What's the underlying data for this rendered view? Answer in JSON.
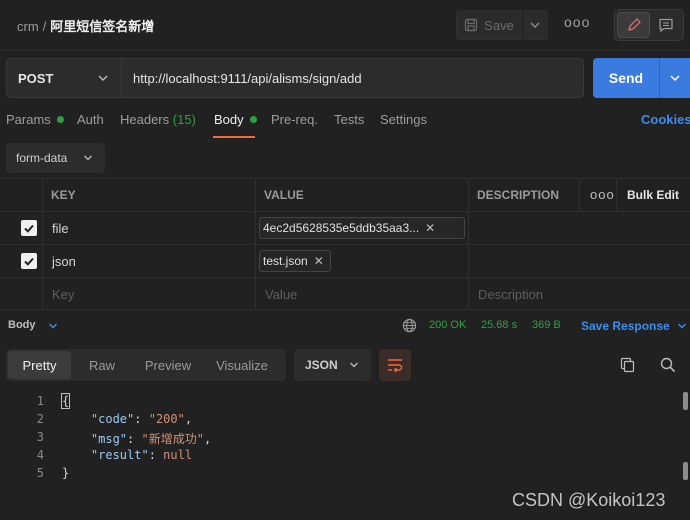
{
  "breadcrumb": {
    "workspace": "crm",
    "separator": "/",
    "request_name": "阿里短信签名新增"
  },
  "toolbar": {
    "save_label": "Save",
    "more": "ooo"
  },
  "request": {
    "method": "POST",
    "url": "http://localhost:9111/api/alisms/sign/add",
    "send_label": "Send"
  },
  "tabs": {
    "params": "Params",
    "auth": "Auth",
    "headers": "Headers",
    "headers_count": "(15)",
    "body": "Body",
    "prereq": "Pre-req.",
    "tests": "Tests",
    "settings": "Settings",
    "cookies": "Cookies"
  },
  "body_mode": "form-data",
  "table": {
    "headers": {
      "key": "KEY",
      "value": "VALUE",
      "description": "DESCRIPTION",
      "more": "ooo",
      "bulk_edit": "Bulk Edit"
    },
    "rows": [
      {
        "key": "file",
        "value": "4ec2d5628535e5ddb35aa3...",
        "checked": true
      },
      {
        "key": "json",
        "value": "test.json",
        "checked": true
      }
    ],
    "placeholders": {
      "key": "Key",
      "value": "Value",
      "description": "Description"
    }
  },
  "response": {
    "body_label": "Body",
    "status": "200 OK",
    "time": "25.68 s",
    "size": "369 B",
    "save_response": "Save Response",
    "views": [
      "Pretty",
      "Raw",
      "Preview",
      "Visualize"
    ],
    "active_view": "Pretty",
    "format": "JSON",
    "lines": [
      {
        "n": "1"
      },
      {
        "n": "2",
        "key": "\"code\"",
        "val": "\"200\""
      },
      {
        "n": "3",
        "key": "\"msg\"",
        "val": "\"新增成功\""
      },
      {
        "n": "4",
        "key": "\"result\"",
        "val": "null"
      },
      {
        "n": "5"
      }
    ],
    "open_brace": "{",
    "close_brace": "}"
  },
  "colors": {
    "accent_blue": "#3a7be0",
    "status_green": "#2ea043",
    "tab_underline": "#f26b3a"
  },
  "watermark": "CSDN @Koikoi123"
}
